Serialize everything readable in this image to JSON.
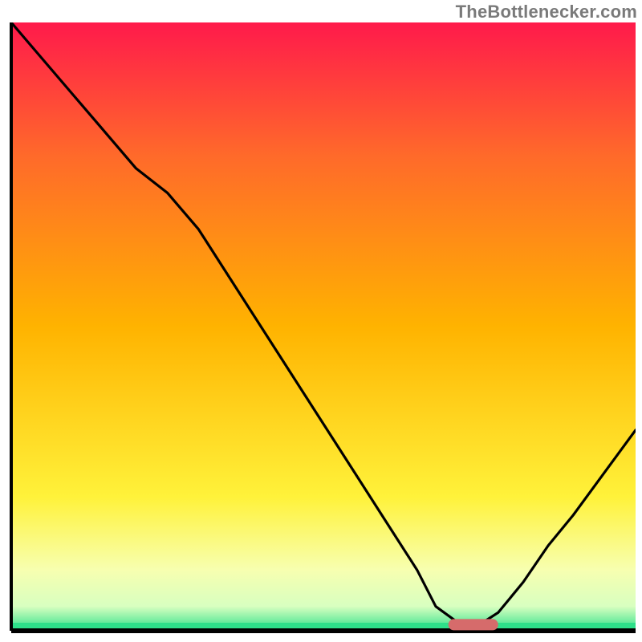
{
  "watermark": {
    "text": "TheBottlenecker.com"
  },
  "colors": {
    "gradient": {
      "top": "#ff1a4b",
      "midUpper": "#ff6a2a",
      "mid": "#ffb300",
      "midLower": "#fff23a",
      "lower": "#f7ffb0",
      "light": "#d8ffc0",
      "bottom": "#2ee08a"
    },
    "axis": "#000000",
    "curve": "#000000",
    "marker": "#d66b6b"
  },
  "chart_data": {
    "type": "line",
    "title": "",
    "xlabel": "",
    "ylabel": "",
    "xlim": [
      0,
      100
    ],
    "ylim": [
      0,
      100
    ],
    "grid": false,
    "legend": null,
    "series": [
      {
        "name": "bottleneck-curve",
        "x": [
          0,
          5,
          10,
          15,
          20,
          25,
          30,
          35,
          40,
          45,
          50,
          55,
          60,
          65,
          68,
          72,
          75,
          78,
          82,
          86,
          90,
          95,
          100
        ],
        "values": [
          100,
          94,
          88,
          82,
          76,
          72,
          66,
          58,
          50,
          42,
          34,
          26,
          18,
          10,
          4,
          1,
          1,
          3,
          8,
          14,
          19,
          26,
          33
        ]
      }
    ],
    "marker": {
      "x_start": 70,
      "x_end": 78,
      "y": 1
    },
    "annotations": []
  }
}
